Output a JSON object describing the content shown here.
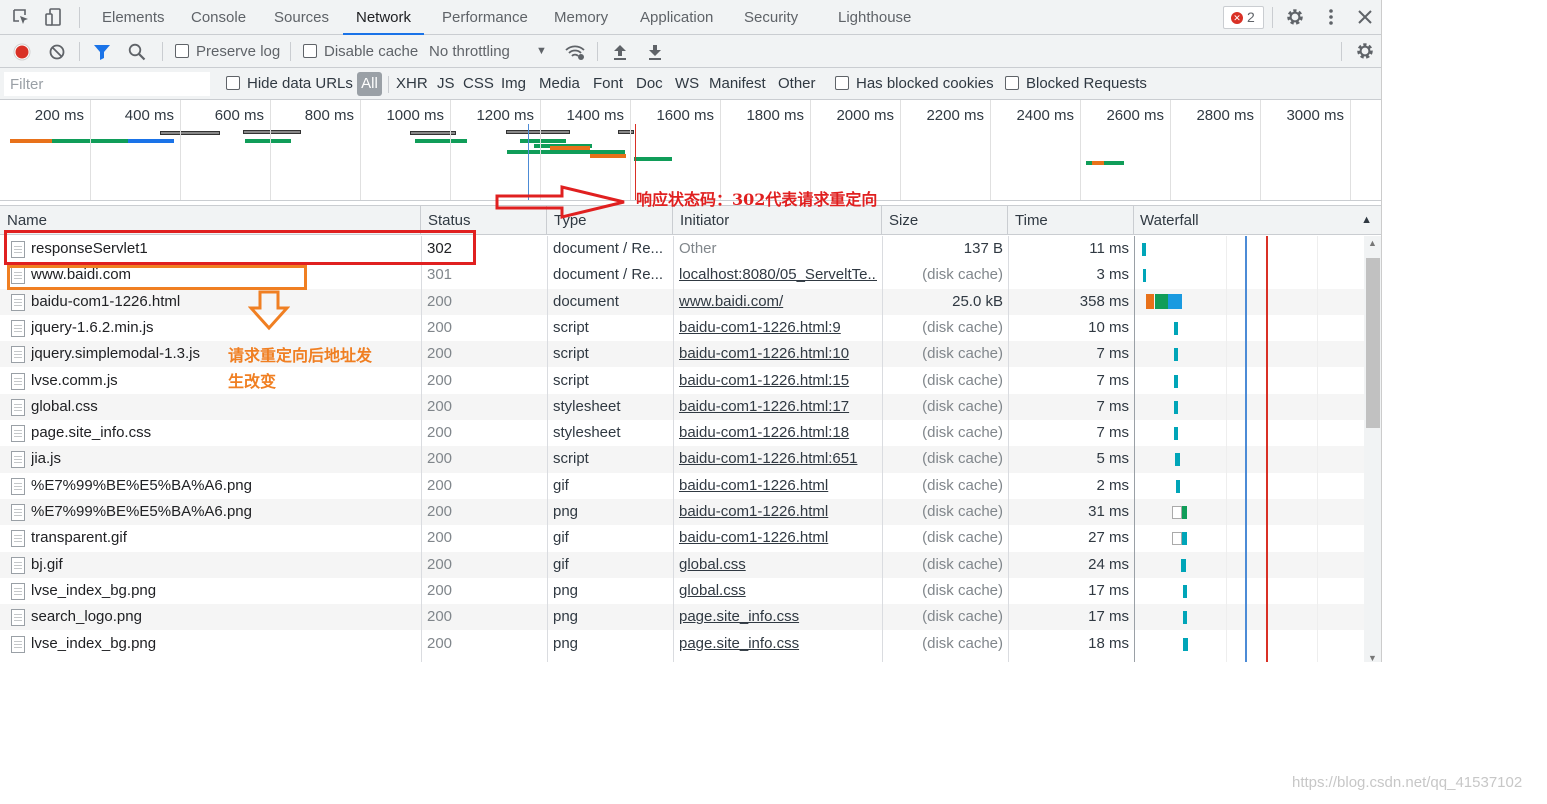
{
  "tabs": [
    {
      "label": "Elements"
    },
    {
      "label": "Console"
    },
    {
      "label": "Sources"
    },
    {
      "label": "Network",
      "active": true
    },
    {
      "label": "Performance"
    },
    {
      "label": "Memory"
    },
    {
      "label": "Application"
    },
    {
      "label": "Security"
    },
    {
      "label": "Lighthouse"
    }
  ],
  "error_count": "2",
  "toolbar": {
    "preserve_log": "Preserve log",
    "disable_cache": "Disable cache",
    "throttling": "No throttling"
  },
  "filterbar": {
    "placeholder": "Filter",
    "hide_data_urls": "Hide data URLs",
    "all": "All",
    "types": [
      "XHR",
      "JS",
      "CSS",
      "Img",
      "Media",
      "Font",
      "Doc",
      "WS",
      "Manifest",
      "Other"
    ],
    "has_blocked_cookies": "Has blocked cookies",
    "blocked_requests": "Blocked Requests"
  },
  "overview_ticks": [
    "200 ms",
    "400 ms",
    "600 ms",
    "800 ms",
    "1000 ms",
    "1200 ms",
    "1400 ms",
    "1600 ms",
    "1800 ms",
    "2000 ms",
    "2200 ms",
    "2400 ms",
    "2600 ms",
    "2800 ms",
    "3000 ms"
  ],
  "columns": {
    "name": "Name",
    "status": "Status",
    "type": "Type",
    "initiator": "Initiator",
    "size": "Size",
    "time": "Time",
    "waterfall": "Waterfall"
  },
  "rows": [
    {
      "name": "responseServlet1",
      "status": "302",
      "type": "document / Re...",
      "initiator": "Other",
      "size": "137 B",
      "time": "11 ms"
    },
    {
      "name": "www.baidi.com",
      "status": "301",
      "type": "document / Re...",
      "initiator": "localhost:8080/05_ServeltTe...",
      "size": "(disk cache)",
      "time": "3 ms"
    },
    {
      "name": "baidu-com1-1226.html",
      "status": "200",
      "type": "document",
      "initiator": "www.baidi.com/",
      "size": "25.0 kB",
      "time": "358 ms"
    },
    {
      "name": "jquery-1.6.2.min.js",
      "status": "200",
      "type": "script",
      "initiator": "baidu-com1-1226.html:9",
      "size": "(disk cache)",
      "time": "10 ms"
    },
    {
      "name": "jquery.simplemodal-1.3.js",
      "status": "200",
      "type": "script",
      "initiator": "baidu-com1-1226.html:10",
      "size": "(disk cache)",
      "time": "7 ms"
    },
    {
      "name": "lvse.comm.js",
      "status": "200",
      "type": "script",
      "initiator": "baidu-com1-1226.html:15",
      "size": "(disk cache)",
      "time": "7 ms"
    },
    {
      "name": "global.css",
      "status": "200",
      "type": "stylesheet",
      "initiator": "baidu-com1-1226.html:17",
      "size": "(disk cache)",
      "time": "7 ms"
    },
    {
      "name": "page.site_info.css",
      "status": "200",
      "type": "stylesheet",
      "initiator": "baidu-com1-1226.html:18",
      "size": "(disk cache)",
      "time": "7 ms"
    },
    {
      "name": "jia.js",
      "status": "200",
      "type": "script",
      "initiator": "baidu-com1-1226.html:651",
      "size": "(disk cache)",
      "time": "5 ms"
    },
    {
      "name": "%E7%99%BE%E5%BA%A6.png",
      "status": "200",
      "type": "gif",
      "initiator": "baidu-com1-1226.html",
      "size": "(disk cache)",
      "time": "2 ms"
    },
    {
      "name": "%E7%99%BE%E5%BA%A6.png",
      "status": "200",
      "type": "png",
      "initiator": "baidu-com1-1226.html",
      "size": "(disk cache)",
      "time": "31 ms"
    },
    {
      "name": "transparent.gif",
      "status": "200",
      "type": "gif",
      "initiator": "baidu-com1-1226.html",
      "size": "(disk cache)",
      "time": "27 ms"
    },
    {
      "name": "bj.gif",
      "status": "200",
      "type": "gif",
      "initiator": "global.css",
      "size": "(disk cache)",
      "time": "24 ms"
    },
    {
      "name": "lvse_index_bg.png",
      "status": "200",
      "type": "png",
      "initiator": "global.css",
      "size": "(disk cache)",
      "time": "17 ms"
    },
    {
      "name": "search_logo.png",
      "status": "200",
      "type": "png",
      "initiator": "page.site_info.css",
      "size": "(disk cache)",
      "time": "17 ms"
    },
    {
      "name": "lvse_index_bg.png",
      "status": "200",
      "type": "png",
      "initiator": "page.site_info.css",
      "size": "(disk cache)",
      "time": "18 ms"
    }
  ],
  "annotations": {
    "status_note": "响应状态码：302代表请求重定向",
    "redirect_note_line1": "请求重定向后地址发",
    "redirect_note_line2": "生改变",
    "annotation_red": "#e02020",
    "annotation_orange": "#f07f22"
  },
  "watermark": "https://blog.csdn.net/qq_41537102",
  "colors": {
    "accent": "#1a73e8",
    "record_red": "#d93025"
  }
}
